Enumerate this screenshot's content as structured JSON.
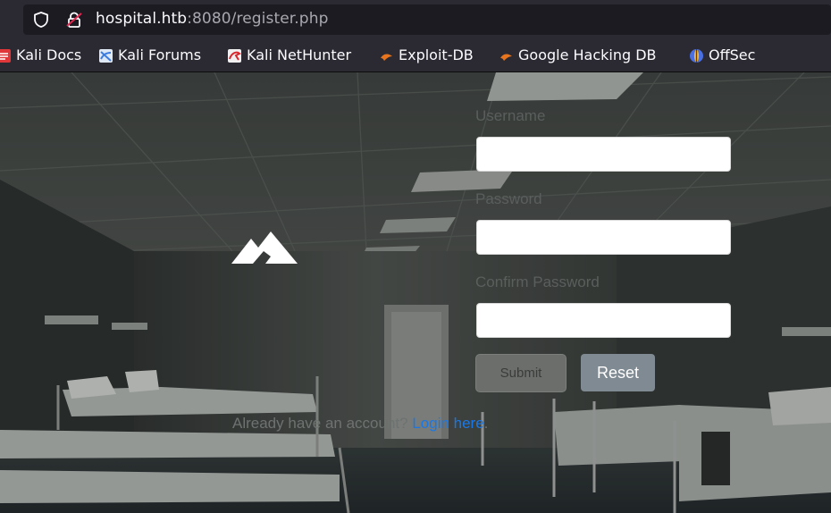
{
  "browser": {
    "url_host": "hospital.htb",
    "url_rest": ":8080/register.php",
    "icons": [
      "shield-icon",
      "lock-icon"
    ],
    "bookmarks": [
      {
        "label": "Kali Docs",
        "icon": "kali-docs-icon",
        "color": "#e0383a"
      },
      {
        "label": "Kali Forums",
        "icon": "kali-forums-icon",
        "color": "#3b7ce0"
      },
      {
        "label": "Kali NetHunter",
        "icon": "kali-nethunter-icon",
        "color": "#d8262c"
      },
      {
        "label": "Exploit-DB",
        "icon": "exploit-db-icon",
        "color": "#e8741e"
      },
      {
        "label": "Google Hacking DB",
        "icon": "google-hacking-db-icon",
        "color": "#e8741e"
      },
      {
        "label": "OffSec",
        "icon": "offsec-icon",
        "color": "#4a6fe0"
      }
    ]
  },
  "form": {
    "logo_icon": "mountain-logo-icon",
    "username_label": "Username",
    "password_label": "Password",
    "confirm_label": "Confirm Password",
    "submit_label": "Submit",
    "reset_label": "Reset",
    "account_text": "Already have an account?",
    "login_link": "Login here",
    "login_suffix": "."
  },
  "colors": {
    "link": "#1a78e6",
    "reset_button": "#7f8a92"
  }
}
